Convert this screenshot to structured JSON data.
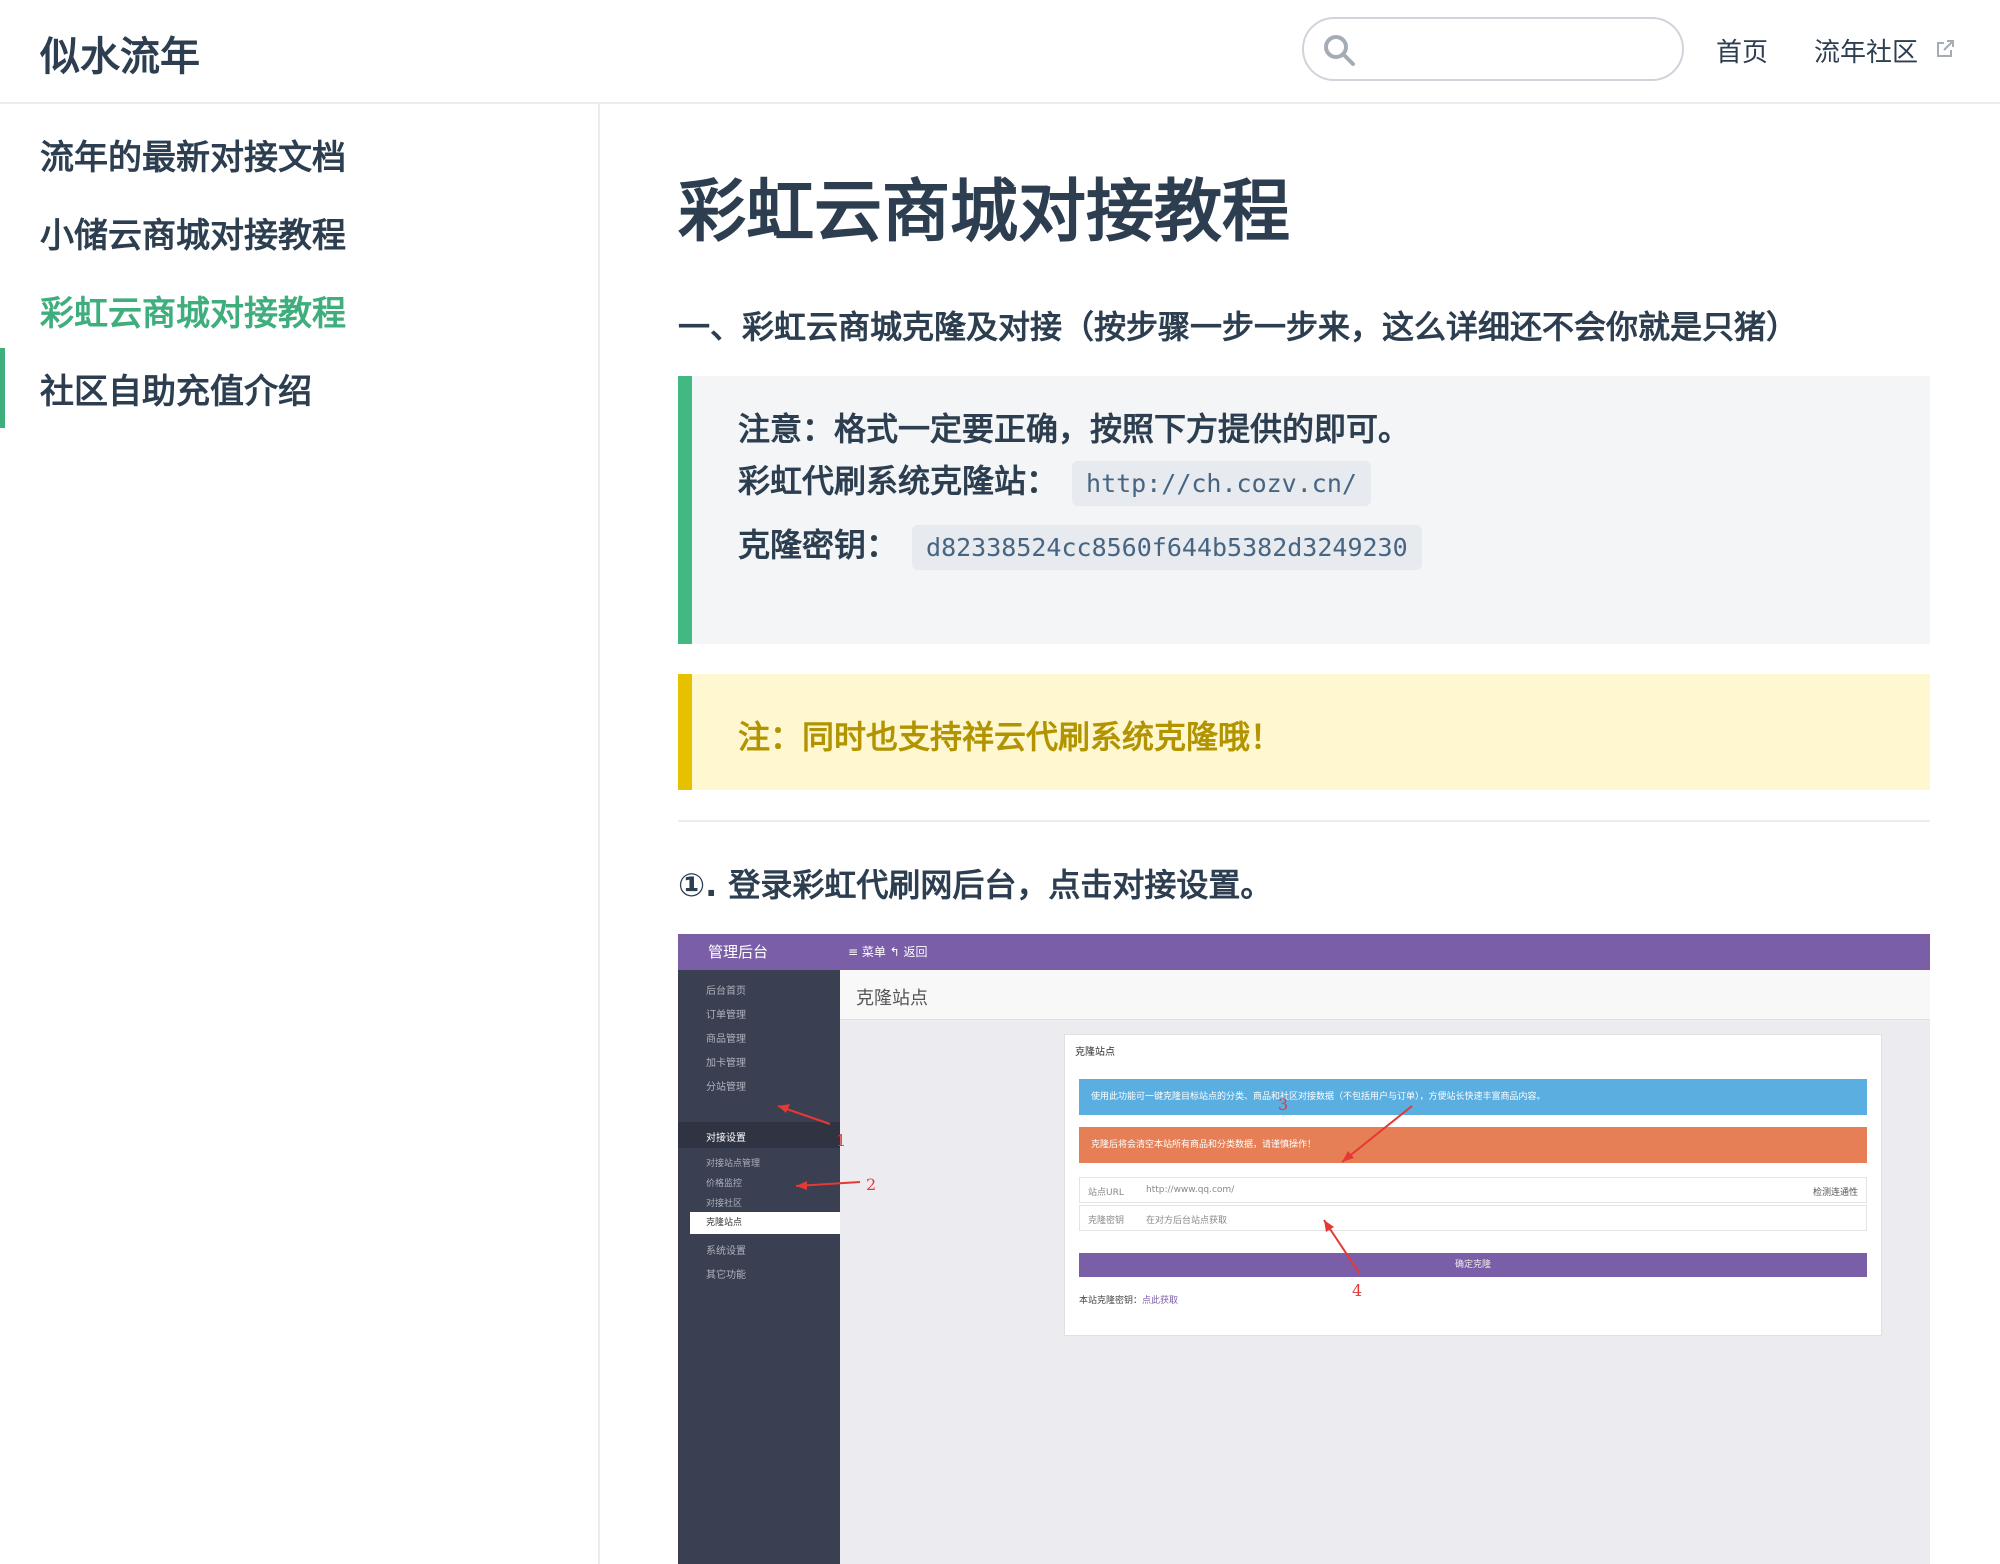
{
  "navbar": {
    "site_name": "似水流年",
    "search": {
      "value": "",
      "placeholder": ""
    },
    "links": [
      {
        "label": "首页"
      },
      {
        "label": "流年社区"
      }
    ]
  },
  "sidebar": {
    "items": [
      {
        "label": "流年的最新对接文档",
        "active": false
      },
      {
        "label": "小储云商城对接教程",
        "active": false
      },
      {
        "label": "彩虹云商城对接教程",
        "active": true
      },
      {
        "label": "社区自助充值介绍",
        "active": false
      }
    ]
  },
  "content": {
    "title": "彩虹云商城对接教程",
    "section_heading": "一、彩虹云商城克隆及对接（按步骤一步一步来，这么详细还不会你就是只猪）",
    "tip": {
      "line1": "注意：格式一定要正确，按照下方提供的即可。",
      "clone_site_label": "彩虹代刷系统克隆站：",
      "clone_site_url": "http://ch.cozv.cn/",
      "clone_key_label": "克隆密钥：",
      "clone_key": "d82338524cc8560f644b5382d3249230"
    },
    "warning": "注：同时也支持祥云代刷系统克隆哦！",
    "step1": "①. 登录彩虹代刷网后台，点击对接设置。"
  },
  "screenshot": {
    "brand": "管理后台",
    "menu": "≡ 菜单  ↰ 返回",
    "page_header": "克隆站点",
    "side_items": [
      "后台首页",
      "订单管理",
      "商品管理",
      "加卡管理",
      "分站管理",
      "对接设置",
      "系统设置",
      "其它功能"
    ],
    "sub_items": [
      "对接站点管理",
      "价格监控",
      "对接社区",
      "克隆站点"
    ],
    "panel_title": "克隆站点",
    "info_text": "使用此功能可一键克隆目标站点的分类、商品和社区对接数据（不包括用户与订单），方便站长快速丰富商品内容。",
    "danger_text": "克隆后将会清空本站所有商品和分类数据，请谨慎操作！",
    "row1_label": "站点URL",
    "row1_value": "http://www.qq.com/",
    "row1_button": "检测连通性",
    "row2_label": "克隆密钥",
    "row2_value": "在对方后台站点获取",
    "button_label": "确定克隆",
    "foot_text": "本站克隆密钥：",
    "foot_link": "点此获取",
    "annotations": [
      "1",
      "2",
      "3",
      "4"
    ],
    "colors": {
      "topbar": "#7b5ea8",
      "sidebar": "#3a3f51",
      "info": "#5aaee0",
      "danger": "#e67f56",
      "arrow": "#e53935"
    }
  },
  "colors": {
    "accent": "#3eaf7c",
    "tip_border": "#42b983",
    "warn_border": "#e7c000",
    "warn_text": "#b29400"
  },
  "icons": {
    "search": "search-icon",
    "external": "external-link-icon"
  }
}
